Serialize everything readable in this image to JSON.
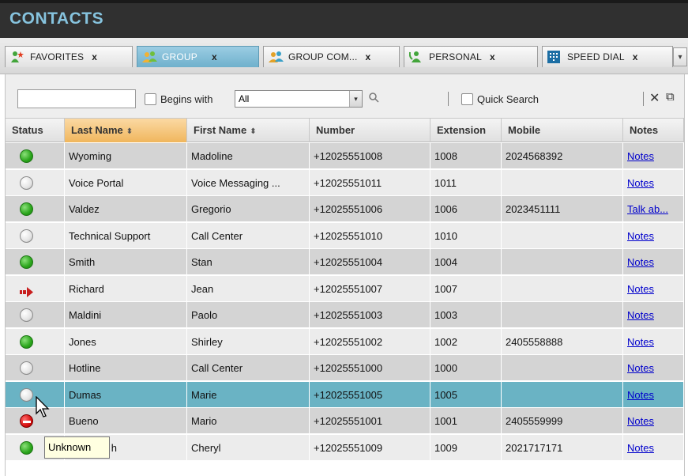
{
  "window": {
    "title": "CONTACTS"
  },
  "tabs": [
    {
      "label": "FAVORITES",
      "close": "x",
      "icon": "favorites-star-person-icon",
      "active": false
    },
    {
      "label": "GROUP",
      "close": "x",
      "icon": "group-people-icon",
      "active": true
    },
    {
      "label": "GROUP COM...",
      "close": "x",
      "icon": "group-common-people-icon",
      "active": false
    },
    {
      "label": "PERSONAL",
      "close": "x",
      "icon": "personal-contact-icon",
      "active": false
    },
    {
      "label": "SPEED DIAL",
      "close": "x",
      "icon": "speed-dial-keypad-icon",
      "active": false
    }
  ],
  "search": {
    "input_value": "",
    "begins_with_label": "Begins with",
    "filter_value": "All",
    "quick_search_label": "Quick Search",
    "close_glyph": "✕",
    "popout_glyph": "⧉"
  },
  "columns": {
    "status": "Status",
    "last_name": "Last Name",
    "first_name": "First Name",
    "number": "Number",
    "extension": "Extension",
    "mobile": "Mobile",
    "notes": "Notes"
  },
  "rows": [
    {
      "status": "available",
      "last": "Wyoming",
      "first": "Madoline",
      "number": "+12025551008",
      "ext": "1008",
      "mobile": "2024568392",
      "notes": "Notes"
    },
    {
      "status": "unknown",
      "last": "Voice Portal",
      "first": "Voice Messaging ...",
      "number": "+12025551011",
      "ext": "1011",
      "mobile": "",
      "notes": "Notes"
    },
    {
      "status": "available",
      "last": "Valdez",
      "first": "Gregorio",
      "number": "+12025551006",
      "ext": "1006",
      "mobile": "2023451111",
      "notes": "Talk ab..."
    },
    {
      "status": "unknown",
      "last": "Technical Support",
      "first": "Call Center",
      "number": "+12025551010",
      "ext": "1010",
      "mobile": "",
      "notes": "Notes"
    },
    {
      "status": "available",
      "last": "Smith",
      "first": "Stan",
      "number": "+12025551004",
      "ext": "1004",
      "mobile": "",
      "notes": "Notes"
    },
    {
      "status": "forwarded",
      "last": "Richard",
      "first": "Jean",
      "number": "+12025551007",
      "ext": "1007",
      "mobile": "",
      "notes": "Notes"
    },
    {
      "status": "unknown",
      "last": "Maldini",
      "first": "Paolo",
      "number": "+12025551003",
      "ext": "1003",
      "mobile": "",
      "notes": "Notes"
    },
    {
      "status": "available",
      "last": "Jones",
      "first": "Shirley",
      "number": "+12025551002",
      "ext": "1002",
      "mobile": "2405558888",
      "notes": "Notes"
    },
    {
      "status": "unknown",
      "last": "Hotline",
      "first": "Call Center",
      "number": "+12025551000",
      "ext": "1000",
      "mobile": "",
      "notes": "Notes"
    },
    {
      "status": "unknown",
      "last": "Dumas",
      "first": "Marie",
      "number": "+12025551005",
      "ext": "1005",
      "mobile": "",
      "notes": "Notes",
      "selected": true
    },
    {
      "status": "busy",
      "last": "Bueno",
      "first": "Mario",
      "number": "+12025551001",
      "ext": "1001",
      "mobile": "2405559999",
      "notes": "Notes"
    },
    {
      "status": "available",
      "last": "h",
      "first": "Cheryl",
      "number": "+12025551009",
      "ext": "1009",
      "mobile": "2021717171",
      "notes": "Notes"
    }
  ],
  "tooltip": {
    "text": "Unknown"
  },
  "colors": {
    "title": "#86c3de",
    "active_tab": "#6fb0cc",
    "selected_row": "#6ab3c4",
    "sorted_header": "#f0b65d",
    "link": "#0000cc"
  }
}
